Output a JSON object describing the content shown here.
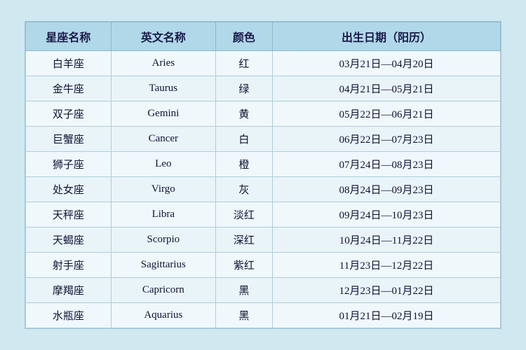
{
  "table": {
    "headers": {
      "col1": "星座名称",
      "col2": "英文名称",
      "col3": "颜色",
      "col4": "出生日期（阳历）"
    },
    "rows": [
      {
        "chinese": "白羊座",
        "english": "Aries",
        "color": "红",
        "date": "03月21日—04月20日"
      },
      {
        "chinese": "金牛座",
        "english": "Taurus",
        "color": "绿",
        "date": "04月21日—05月21日"
      },
      {
        "chinese": "双子座",
        "english": "Gemini",
        "color": "黄",
        "date": "05月22日—06月21日"
      },
      {
        "chinese": "巨蟹座",
        "english": "Cancer",
        "color": "白",
        "date": "06月22日—07月23日"
      },
      {
        "chinese": "狮子座",
        "english": "Leo",
        "color": "橙",
        "date": "07月24日—08月23日"
      },
      {
        "chinese": "处女座",
        "english": "Virgo",
        "color": "灰",
        "date": "08月24日—09月23日"
      },
      {
        "chinese": "天秤座",
        "english": "Libra",
        "color": "淡红",
        "date": "09月24日—10月23日"
      },
      {
        "chinese": "天蝎座",
        "english": "Scorpio",
        "color": "深红",
        "date": "10月24日—11月22日"
      },
      {
        "chinese": "射手座",
        "english": "Sagittarius",
        "color": "紫红",
        "date": "11月23日—12月22日"
      },
      {
        "chinese": "摩羯座",
        "english": "Capricorn",
        "color": "黑",
        "date": "12月23日—01月22日"
      },
      {
        "chinese": "水瓶座",
        "english": "Aquarius",
        "color": "黑",
        "date": "01月21日—02月19日"
      }
    ]
  }
}
